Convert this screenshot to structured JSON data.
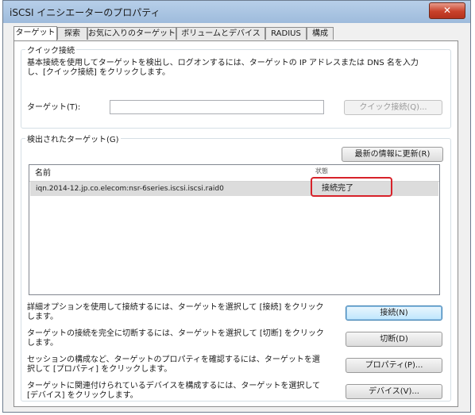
{
  "window": {
    "title": "iSCSI イニシエーターのプロパティ",
    "close_label": "✕"
  },
  "tabs": [
    {
      "label": "ターゲット"
    },
    {
      "label": "探索"
    },
    {
      "label": "お気に入りのターゲット"
    },
    {
      "label": "ボリュームとデバイス"
    },
    {
      "label": "RADIUS"
    },
    {
      "label": "構成"
    }
  ],
  "quick_connect": {
    "group_title": "クイック接続",
    "description_line1": "基本接続を使用してターゲットを検出し、ログオンするには、ターゲットの IP アドレスまたは DNS 名を入力",
    "description_line2": "し、[クイック接続] をクリックします。",
    "target_label": "ターゲット(T):",
    "target_value": "",
    "quick_connect_button": "クイック接続(Q)..."
  },
  "discovered_targets": {
    "group_title": "検出されたターゲット(G)",
    "refresh_button": "最新の情報に更新(R)",
    "columns": {
      "name": "名前",
      "status": "状態"
    },
    "rows": [
      {
        "name": "iqn.2014-12.jp.co.elecom:nsr-6series.iscsi.iscsi.raid0",
        "status": "接続完了"
      }
    ]
  },
  "actions": [
    {
      "text": "詳細オプションを使用して接続するには、ターゲットを選択して [接続] をクリックします。",
      "button": "接続(N)"
    },
    {
      "text": "ターゲットの接続を完全に切断するには、ターゲットを選択して [切断] をクリックします。",
      "button": "切断(D)"
    },
    {
      "text": "セッションの構成など、ターゲットのプロパティを確認するには、ターゲットを選択して [プロパティ] をクリックします。",
      "button": "プロパティ(P)..."
    },
    {
      "text": "ターゲットに関連付けられているデバイスを構成するには、ターゲットを選択して [デバイス] をクリックします。",
      "button": "デバイス(V)..."
    }
  ]
}
